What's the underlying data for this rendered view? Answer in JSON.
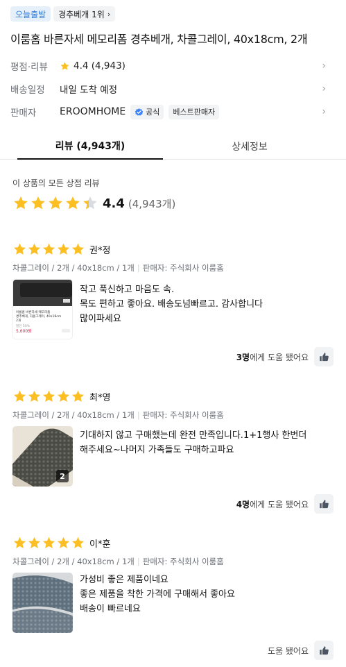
{
  "colors": {
    "star": "#fbbf24",
    "star_empty": "#d9dce1",
    "accent_blue": "#2b7ad8"
  },
  "header": {
    "chip_delivery": "오늘출발",
    "chip_rank": "경추베개 1위",
    "title": "이룸홈 바른자세 메모리폼 경추베개, 차콜그레이, 40x18cm, 2개"
  },
  "info": {
    "rating_label": "평점·리뷰",
    "rating_value": "4.4 (4,943)",
    "shipping_label": "배송일정",
    "shipping_value": "내일 도착 예정",
    "seller_label": "판매자",
    "seller_name": "EROOMHOME",
    "badge_official": "공식",
    "badge_bestseller": "베스트판매자"
  },
  "tabs": {
    "reviews": "리뷰 (4,943개)",
    "details": "상세정보"
  },
  "summary": {
    "label": "이 상품의 모든 상점 리뷰",
    "rating": 4.4,
    "score": "4.4",
    "count": "(4,943개)"
  },
  "reviews": [
    {
      "rating": 5,
      "name": "권*정",
      "option": "차콜그레이 / 2개 / 40x18cm / 1개",
      "seller": "판매자: 주식회사 이룸홈",
      "lines": [
        "작고 푹신하고 마음도 속.",
        "목도 편하고 좋아요. 배송도넘빠르고.  감사합니다",
        "많이파세요"
      ],
      "thumb_lines": [
        "이룸홈 바른자세 메모리폼",
        "경추베개, 차콜그레이, 40x18cm",
        "2개"
      ],
      "thumb_sale": "할인 50%",
      "thumb_price": "5,600원",
      "helpful_count": "3명",
      "helpful_text": "에게 도움 됐어요",
      "photo_count": ""
    },
    {
      "rating": 5,
      "name": "최*영",
      "option": "차콜그레이 / 2개 / 40x18cm / 1개",
      "seller": "판매자: 주식회사 이룸홈",
      "lines": [
        "기대하지 않고 구매했는데 완전 만족입니다.1+1행사 한번더",
        "해주세요~나머지 가족들도 구매하고파요"
      ],
      "helpful_count": "4명",
      "helpful_text": "에게 도움 됐어요",
      "photo_count": "2"
    },
    {
      "rating": 5,
      "name": "이*훈",
      "option": "차콜그레이 / 2개 / 40x18cm / 1개",
      "seller": "판매자: 주식회사 이룸홈",
      "lines": [
        "가성비 좋은 제품이네요",
        "좋은 제품을 착한 가격에 구매해서 좋아요",
        "배송이 빠르네요"
      ],
      "helpful_count": "",
      "helpful_text": "도움 됐어요",
      "photo_count": ""
    }
  ]
}
